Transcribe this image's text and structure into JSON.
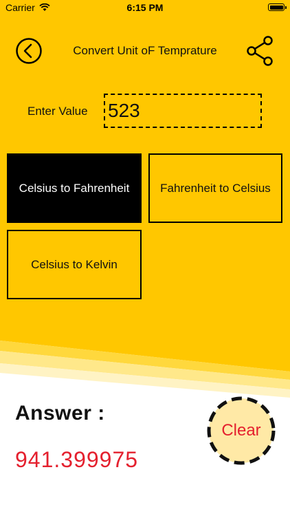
{
  "status_bar": {
    "carrier": "Carrier",
    "time": "6:15 PM"
  },
  "header": {
    "title": "Convert Unit oF Temprature"
  },
  "input": {
    "label": "Enter Value",
    "value": "523"
  },
  "buttons": {
    "celsius_to_fahrenheit": "Celsius to Fahrenheit",
    "fahrenheit_to_celsius": "Fahrenheit to Celsius",
    "celsius_to_kelvin": "Celsius to Kelvin",
    "clear": "Clear"
  },
  "result": {
    "label": "Answer :",
    "value": "941.399975"
  },
  "colors": {
    "background": "#ffc700",
    "answer": "#e4202e",
    "clear_fill": "#ffe9a6"
  }
}
